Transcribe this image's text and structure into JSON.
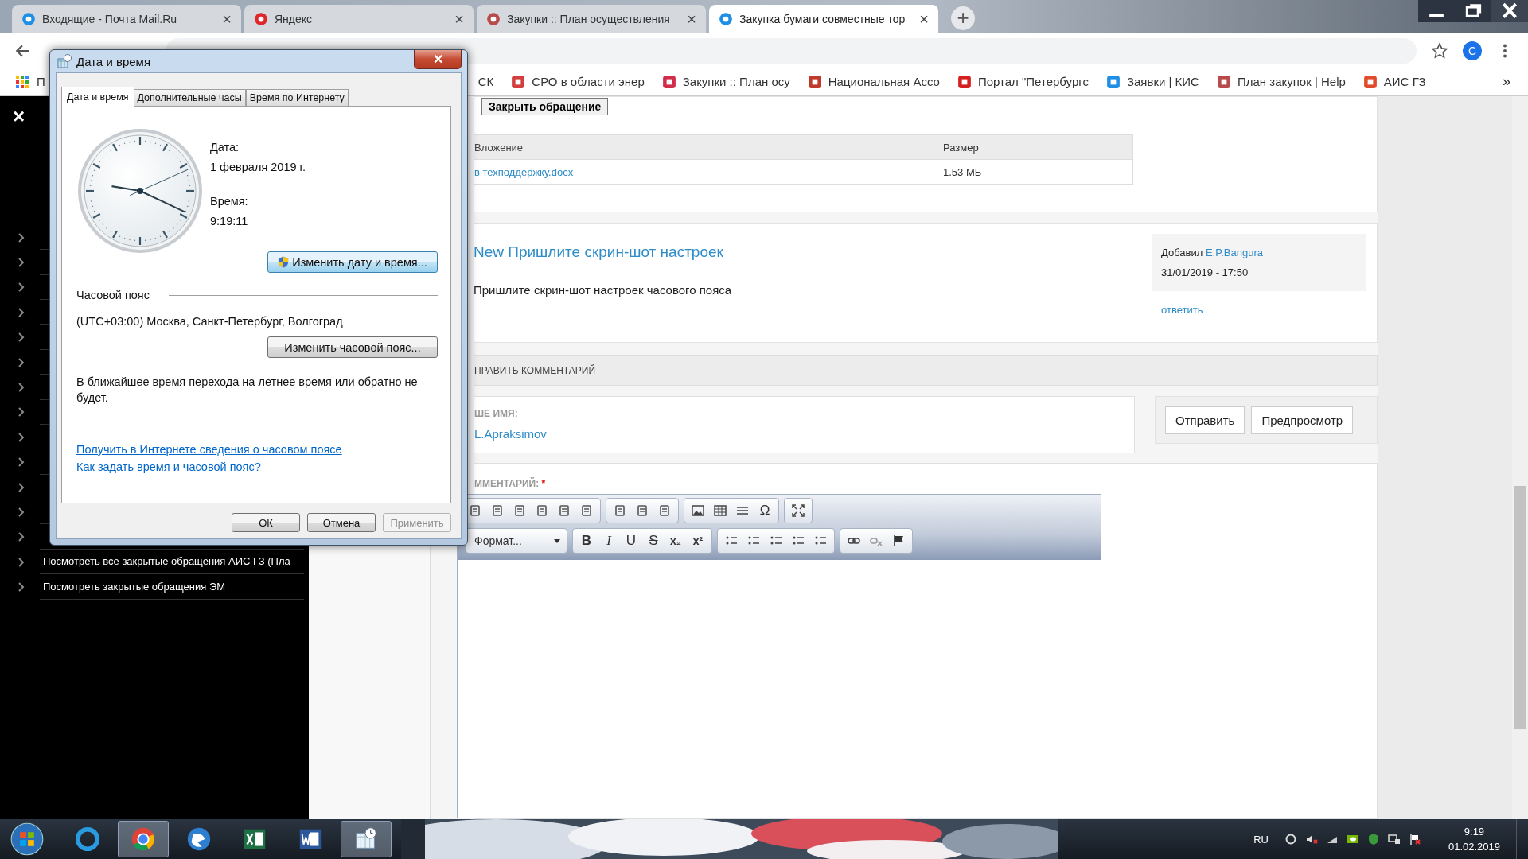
{
  "browser": {
    "tabs": [
      {
        "title": "Входящие - Почта Mail.Ru",
        "close": "×",
        "selected": false
      },
      {
        "title": "Яндекс",
        "close": "×",
        "selected": false
      },
      {
        "title": "Закупки :: План осуществления",
        "close": "×",
        "selected": false
      },
      {
        "title": "Закупка бумаги совместные тор",
        "close": "×",
        "selected": true
      }
    ],
    "new_tab": "+",
    "profile_initial": "С",
    "bookmarks_more": "»",
    "bookmarks": [
      {
        "label": "П"
      },
      {
        "label": "СК"
      },
      {
        "label": "СРО в области энер"
      },
      {
        "label": "Закупки :: План осу"
      },
      {
        "label": "Национальная Ассо"
      },
      {
        "label": "Портал \"Петербургс"
      },
      {
        "label": "Заявки | КИС"
      },
      {
        "label": "План закупок | Help"
      },
      {
        "label": "АИС ГЗ"
      }
    ]
  },
  "sidebar": {
    "close_glyph": "×",
    "items": [
      {
        "kind": "covered"
      },
      {
        "kind": "covered"
      },
      {
        "kind": "covered"
      },
      {
        "kind": "covered"
      },
      {
        "kind": "covered"
      },
      {
        "kind": "covered"
      },
      {
        "kind": "covered"
      },
      {
        "kind": "covered"
      },
      {
        "kind": "covered"
      },
      {
        "kind": "covered"
      },
      {
        "kind": "covered"
      },
      {
        "kind": "covered"
      },
      {
        "kind": "covered"
      },
      {
        "kind": "link",
        "label": "Посмотреть все закрытые обращения АИС ГЗ (Пла"
      },
      {
        "kind": "link",
        "label": "Посмотреть закрытые обращения ЭМ"
      }
    ]
  },
  "page": {
    "close_request_button": "Закрыть обращение",
    "attachments": {
      "columns": [
        "Вложение",
        "Размер"
      ],
      "rows": [
        [
          "в техподдержку.docx",
          "1.53 МБ"
        ]
      ]
    },
    "comment": {
      "title": "New Пришлите скрин-шот настроек",
      "body": "Пришлите скрин-шот настроек часового пояса",
      "added_by": "Добавил",
      "author": "E.P.Bangura",
      "datetime": "31/01/2019 - 17:50",
      "reply": "ответить"
    },
    "form": {
      "section_title": "ПРАВИТЬ КОММЕНТАРИЙ",
      "name_label": "ШЕ ИМЯ:",
      "name": "L.Apraksimov",
      "comment_label": "ММЕНТАРИЙ:",
      "required_mark": "*",
      "special_char": "Ω",
      "format_dropdown": "Формат...",
      "text_buttons": [
        "B",
        "I",
        "U",
        "S"
      ],
      "script_buttons": [
        "x₂",
        "x²"
      ],
      "buttons": [
        "Отправить",
        "Предпросмотр"
      ]
    }
  },
  "dialog": {
    "title": "Дата и время",
    "close": "✕",
    "tabs": [
      {
        "label": "Дата и время",
        "selected": true
      },
      {
        "label": "Дополнительные часы",
        "selected": false
      },
      {
        "label": "Время по Интернету",
        "selected": false
      }
    ],
    "date_label": "Дата:",
    "date": "1 февраля 2019 г.",
    "time_label": "Время:",
    "time": "9:19:11",
    "change_datetime_button": "Изменить дату и время...",
    "timezone_heading": "Часовой пояс",
    "timezone": "(UTC+03:00) Москва, Санкт-Петербург, Волгоград",
    "change_timezone_button": "Изменить часовой пояс...",
    "dst_note": "В ближайшее время перехода на летнее время или обратно не будет.",
    "links": [
      "Получить в Интернете сведения о часовом поясе",
      "Как задать время и часовой пояс?"
    ],
    "buttons": [
      {
        "label": "ОК",
        "disabled": false
      },
      {
        "label": "Отмена",
        "disabled": false
      },
      {
        "label": "Применить",
        "disabled": true
      }
    ]
  },
  "taskbar": {
    "apps": [
      {
        "selected": false
      },
      {
        "selected": true
      },
      {
        "selected": false
      },
      {
        "selected": false
      },
      {
        "selected": false
      },
      {
        "selected": true
      }
    ],
    "language": "RU",
    "time": "9:19",
    "date": "01.02.2019"
  }
}
